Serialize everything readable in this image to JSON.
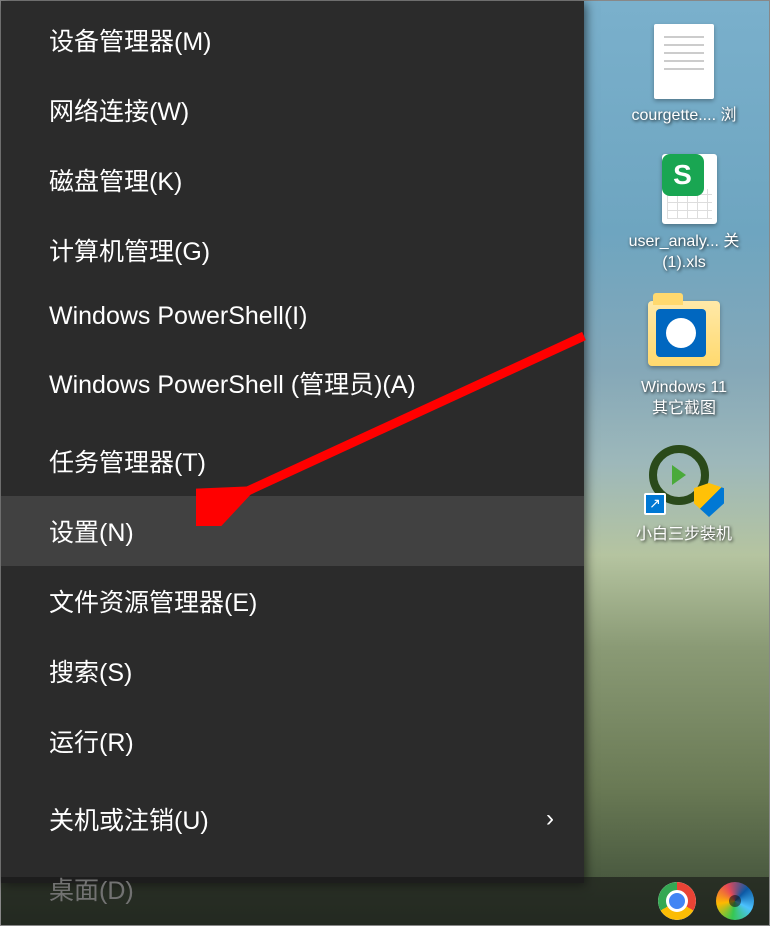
{
  "menu": {
    "sections": [
      [
        {
          "id": "device-manager",
          "label": "设备管理器(M)"
        },
        {
          "id": "network-connections",
          "label": "网络连接(W)"
        },
        {
          "id": "disk-management",
          "label": "磁盘管理(K)"
        },
        {
          "id": "computer-management",
          "label": "计算机管理(G)"
        },
        {
          "id": "powershell",
          "label": "Windows PowerShell(I)"
        },
        {
          "id": "powershell-admin",
          "label": "Windows PowerShell (管理员)(A)"
        }
      ],
      [
        {
          "id": "task-manager",
          "label": "任务管理器(T)"
        },
        {
          "id": "settings",
          "label": "设置(N)",
          "hover": true
        },
        {
          "id": "file-explorer",
          "label": "文件资源管理器(E)"
        },
        {
          "id": "search",
          "label": "搜索(S)"
        },
        {
          "id": "run",
          "label": "运行(R)"
        }
      ],
      [
        {
          "id": "shutdown",
          "label": "关机或注销(U)",
          "submenu": true
        },
        {
          "id": "desktop",
          "label": "桌面(D)"
        }
      ]
    ]
  },
  "desktop": {
    "icons": [
      {
        "id": "file-courgette",
        "type": "file",
        "label": "courgette.... 浏"
      },
      {
        "id": "file-user-analy",
        "type": "xls",
        "label": "user_analy... 关\n(1).xls"
      },
      {
        "id": "folder-win11",
        "type": "folder",
        "label": "Windows 11\n其它截图"
      },
      {
        "id": "shortcut-xiaobai",
        "type": "xiaobai",
        "label": "小白三步装机"
      }
    ]
  },
  "taskbar": {
    "chrome": "chrome-icon",
    "edge": "edge-icon"
  }
}
